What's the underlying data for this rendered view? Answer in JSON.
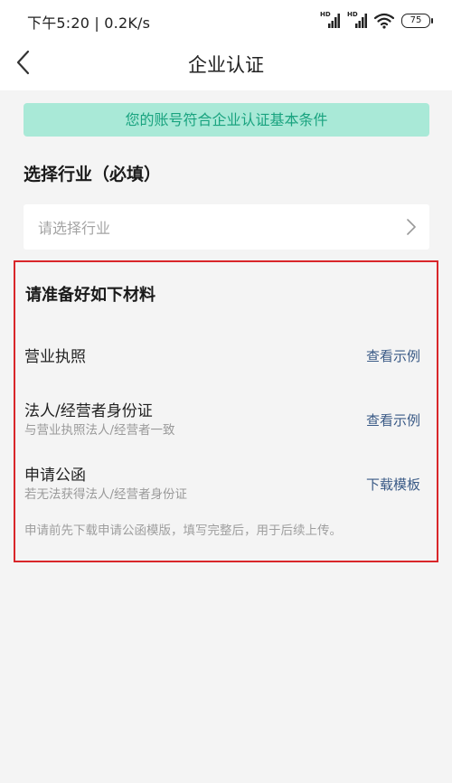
{
  "status_bar": {
    "time": "下午5:20 | 0.2K/s",
    "signal1_label": "HD",
    "signal2_label": "HD",
    "battery": "75",
    "icons": [
      "hd-signal-icon",
      "hd-signal-icon",
      "wifi-icon",
      "battery-icon"
    ]
  },
  "nav": {
    "title": "企业认证",
    "back_icon": "chevron-left-icon"
  },
  "banner": {
    "text": "您的账号符合企业认证基本条件",
    "bg_color": "#a9e9d7",
    "text_color": "#19a37f"
  },
  "industry": {
    "section_title": "选择行业（必填）",
    "placeholder": "请选择行业",
    "chevron_icon": "chevron-right-icon"
  },
  "materials": {
    "title": "请准备好如下材料",
    "items": [
      {
        "title": "营业执照",
        "subtitle": "",
        "link": "查看示例"
      },
      {
        "title": "法人/经营者身份证",
        "subtitle": "与营业执照法人/经营者一致",
        "link": "查看示例"
      },
      {
        "title": "申请公函",
        "subtitle": "若无法获得法人/经营者身份证",
        "link": "下载模板"
      }
    ],
    "note": "申请前先下载申请公函模版，填写完整后，用于后续上传。",
    "highlight_color": "#d9262a",
    "link_color": "#3a5a86"
  }
}
